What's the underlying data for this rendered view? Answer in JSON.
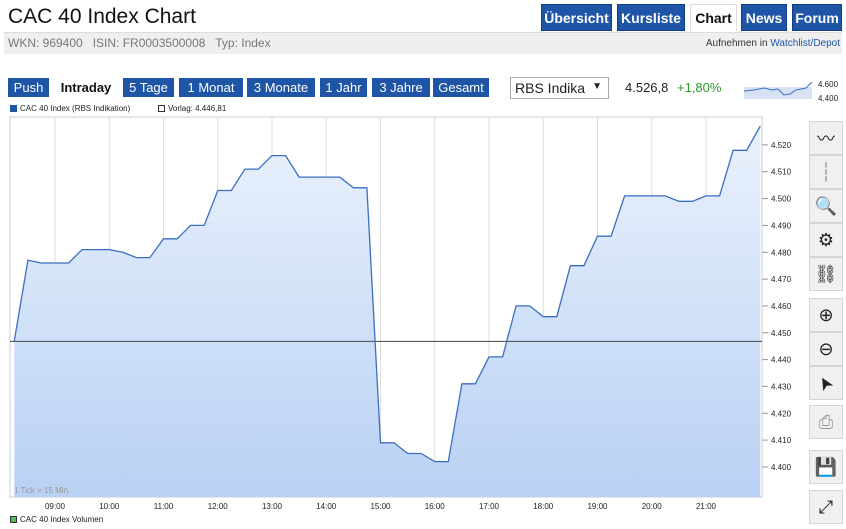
{
  "header": {
    "title": "CAC 40 Index Chart",
    "nav": [
      {
        "label": "Übersicht"
      },
      {
        "label": "Kursliste"
      },
      {
        "label": "Chart",
        "active": true
      },
      {
        "label": "News"
      },
      {
        "label": "Forum"
      }
    ]
  },
  "info": {
    "text": "WKN: 969400   ISIN: FR0003500008   Typ: Index",
    "watch_prefix": "Aufnehmen in ",
    "watch_link": "Watchlist/Depot"
  },
  "ranges": [
    {
      "label": "Push"
    },
    {
      "label": "Intraday",
      "active": true
    },
    {
      "label": "5 Tage"
    },
    {
      "label": "1 Monat"
    },
    {
      "label": "3 Monate"
    },
    {
      "label": "1 Jahr"
    },
    {
      "label": "3 Jahre"
    },
    {
      "label": "Gesamt"
    }
  ],
  "source_select": {
    "value": "RBS Indika"
  },
  "quote": {
    "price": "4.526,8",
    "change": "+1,80%"
  },
  "mini_chart": {
    "high": "4.600",
    "low": "4.400"
  },
  "legend": {
    "series": "CAC 40 Index (RBS Indikation)",
    "prev": "Vorlag: 4.446,81",
    "volume": "CAC 40 Index Volumen",
    "tick_note": "1 Tick = 15 Min."
  },
  "colors": {
    "accent": "#1f55a6",
    "line": "#3a6fc0",
    "fill": "#c4d8f5",
    "positive": "#2a9a2a",
    "volume": "#5cb85c"
  },
  "toolbar": [
    "line-chart-icon",
    "candlestick-icon",
    "analysis-zoom-icon",
    "settings-gears-icon",
    "link-icon",
    "zoom-in-icon",
    "zoom-out-icon",
    "pointer-icon",
    "print-icon",
    "save-icon",
    "fullscreen-icon"
  ],
  "chart_data": {
    "type": "area",
    "x_tick_labels": [
      "09:00",
      "10:00",
      "11:00",
      "12:00",
      "13:00",
      "14:00",
      "15:00",
      "16:00",
      "17:00",
      "18:00",
      "19:00",
      "20:00",
      "21:00"
    ],
    "y_tick_labels": [
      "4.520",
      "4.510",
      "4.500",
      "4.490",
      "4.480",
      "4.470",
      "4.460",
      "4.450",
      "4.440",
      "4.430",
      "4.420",
      "4.410",
      "4.400"
    ],
    "ylim": [
      4.3888,
      4.5304
    ],
    "reference_line": 4.44681,
    "grid": true,
    "x": [
      "08:15",
      "08:30",
      "08:45",
      "09:00",
      "09:15",
      "09:30",
      "09:45",
      "10:00",
      "10:15",
      "10:30",
      "10:45",
      "11:00",
      "11:15",
      "11:30",
      "11:45",
      "12:00",
      "12:15",
      "12:30",
      "12:45",
      "13:00",
      "13:15",
      "13:30",
      "13:45",
      "14:00",
      "14:15",
      "14:30",
      "14:45",
      "15:00",
      "15:15",
      "15:30",
      "15:45",
      "16:00",
      "16:15",
      "16:30",
      "16:45",
      "17:00",
      "17:15",
      "17:30",
      "17:45",
      "18:00",
      "18:15",
      "18:30",
      "18:45",
      "19:00",
      "19:15",
      "19:30",
      "19:45",
      "20:00",
      "20:15",
      "20:30",
      "20:45",
      "21:00",
      "21:15",
      "21:30",
      "21:45",
      "22:00"
    ],
    "values": [
      4.447,
      4.477,
      4.476,
      4.476,
      4.476,
      4.481,
      4.481,
      4.481,
      4.48,
      4.478,
      4.478,
      4.485,
      4.485,
      4.49,
      4.49,
      4.503,
      4.503,
      4.511,
      4.511,
      4.516,
      4.516,
      4.508,
      4.508,
      4.508,
      4.508,
      4.504,
      4.504,
      4.409,
      4.409,
      4.405,
      4.405,
      4.402,
      4.402,
      4.431,
      4.431,
      4.441,
      4.441,
      4.46,
      4.46,
      4.456,
      4.456,
      4.475,
      4.475,
      4.486,
      4.486,
      4.501,
      4.501,
      4.501,
      4.501,
      4.499,
      4.499,
      4.501,
      4.501,
      4.518,
      4.518,
      4.527
    ]
  }
}
